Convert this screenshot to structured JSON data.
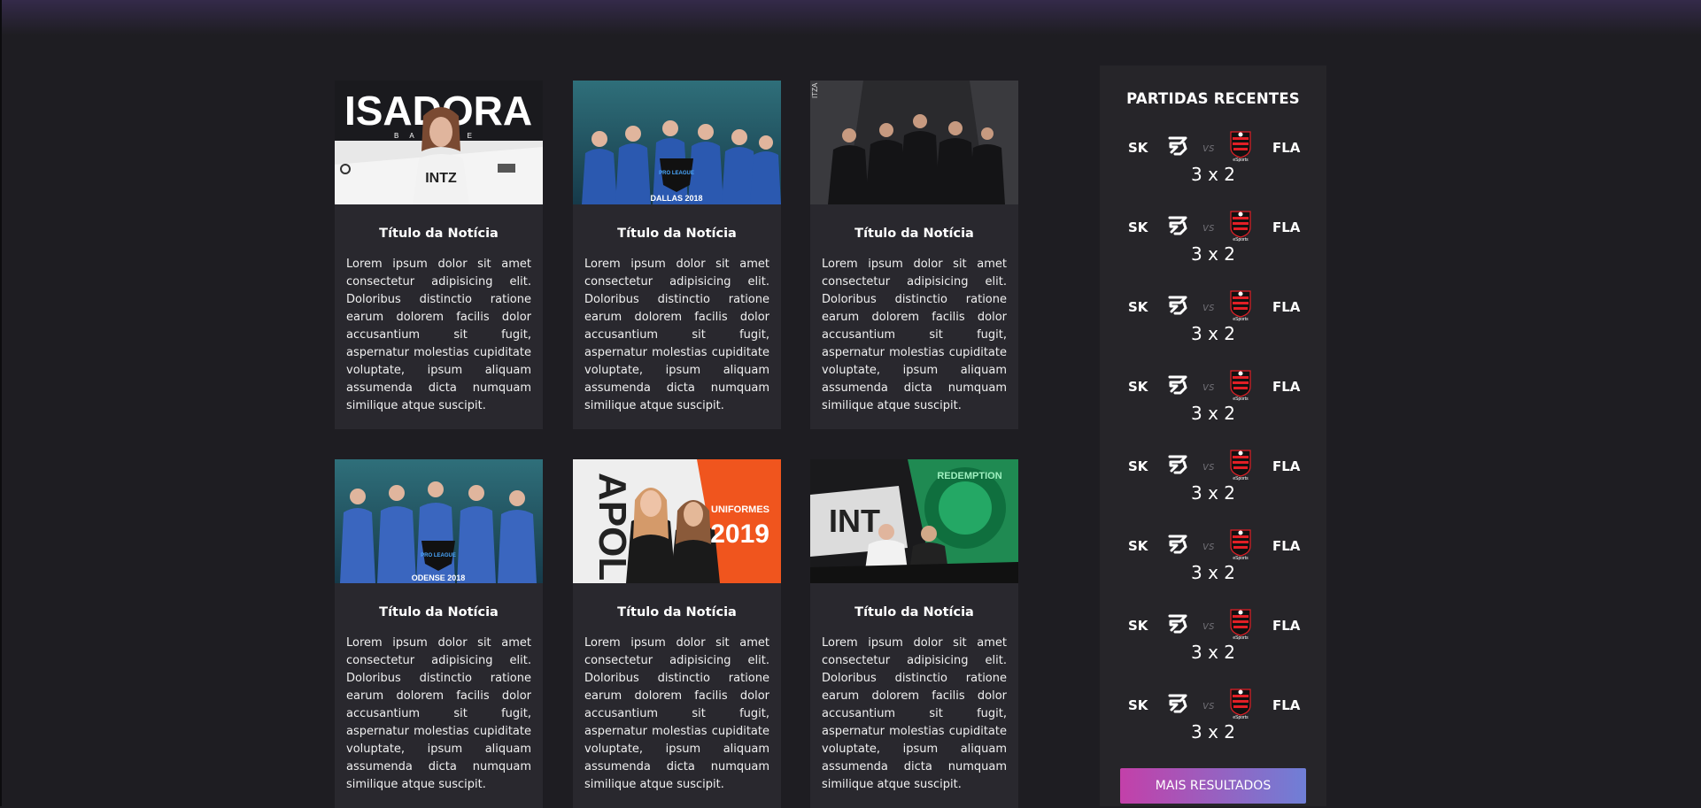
{
  "news": {
    "cards": [
      {
        "title": "Título da Notícia",
        "text": "Lorem ipsum dolor sit amet consectetur adipisicing elit. Doloribus distinctio ratione earum dolorem facilis dolor accusantium sit fugit, aspernatur molestias cupiditate voluptate, ipsum aliquam assumenda dicta numquam similique atque suscipit.",
        "image": {
          "headline": "ISADORA",
          "subline": "BASILE",
          "badge": "INTZ"
        }
      },
      {
        "title": "Título da Notícia",
        "text": "Lorem ipsum dolor sit amet consectetur adipisicing elit. Doloribus distinctio ratione earum dolorem facilis dolor accusantium sit fugit, aspernatur molestias cupiditate voluptate, ipsum aliquam assumenda dicta numquam similique atque suscipit.",
        "image": {
          "league": "PRO LEAGUE",
          "caption": "DALLAS 2018"
        }
      },
      {
        "title": "Título da Notícia",
        "text": "Lorem ipsum dolor sit amet consectetur adipisicing elit. Doloribus distinctio ratione earum dolorem facilis dolor accusantium sit fugit, aspernatur molestias cupiditate voluptate, ipsum aliquam assumenda dicta numquam similique atque suscipit.",
        "image": {
          "side": "ITZA"
        }
      },
      {
        "title": "Título da Notícia",
        "text": "Lorem ipsum dolor sit amet consectetur adipisicing elit. Doloribus distinctio ratione earum dolorem facilis dolor accusantium sit fugit, aspernatur molestias cupiditate voluptate, ipsum aliquam assumenda dicta numquam similique atque suscipit.",
        "image": {
          "league": "PRO LEAGUE",
          "caption": "ODENSE 2018"
        }
      },
      {
        "title": "Título da Notícia",
        "text": "Lorem ipsum dolor sit amet consectetur adipisicing elit. Doloribus distinctio ratione earum dolorem facilis dolor accusantium sit fugit, aspernatur molestias cupiditate voluptate, ipsum aliquam assumenda dicta numquam similique atque suscipit.",
        "image": {
          "side": "APOLLO",
          "headline": "UNIFORMES",
          "year": "2019"
        }
      },
      {
        "title": "Título da Notícia",
        "text": "Lorem ipsum dolor sit amet consectetur adipisicing elit. Doloribus distinctio ratione earum dolorem facilis dolor accusantium sit fugit, aspernatur molestias cupiditate voluptate, ipsum aliquam assumenda dicta numquam similique atque suscipit.",
        "image": {
          "left": "INT",
          "right": "REDEMPTION"
        }
      }
    ]
  },
  "sidebar": {
    "title": "PARTIDAS RECENTES",
    "vs": "vs",
    "matches": [
      {
        "team_a": "SK",
        "team_b": "FLA",
        "score": "3 x 2",
        "logo_a": "sk-logo",
        "logo_b": "flamengo-esports-logo",
        "fla_caption": "eSports"
      },
      {
        "team_a": "SK",
        "team_b": "FLA",
        "score": "3 x 2",
        "logo_a": "sk-logo",
        "logo_b": "flamengo-esports-logo",
        "fla_caption": "eSports"
      },
      {
        "team_a": "SK",
        "team_b": "FLA",
        "score": "3 x 2",
        "logo_a": "sk-logo",
        "logo_b": "flamengo-esports-logo",
        "fla_caption": "eSports"
      },
      {
        "team_a": "SK",
        "team_b": "FLA",
        "score": "3 x 2",
        "logo_a": "sk-logo",
        "logo_b": "flamengo-esports-logo",
        "fla_caption": "eSports"
      },
      {
        "team_a": "SK",
        "team_b": "FLA",
        "score": "3 x 2",
        "logo_a": "sk-logo",
        "logo_b": "flamengo-esports-logo",
        "fla_caption": "eSports"
      },
      {
        "team_a": "SK",
        "team_b": "FLA",
        "score": "3 x 2",
        "logo_a": "sk-logo",
        "logo_b": "flamengo-esports-logo",
        "fla_caption": "eSports"
      },
      {
        "team_a": "SK",
        "team_b": "FLA",
        "score": "3 x 2",
        "logo_a": "sk-logo",
        "logo_b": "flamengo-esports-logo",
        "fla_caption": "eSports"
      },
      {
        "team_a": "SK",
        "team_b": "FLA",
        "score": "3 x 2",
        "logo_a": "sk-logo",
        "logo_b": "flamengo-esports-logo",
        "fla_caption": "eSports"
      }
    ],
    "more_button": "MAIS RESULTADOS"
  },
  "colors": {
    "background": "#1e1d22",
    "card": "#29282e",
    "sidebar": "#262529",
    "button_gradient_start": "#c340a9",
    "button_gradient_end": "#6f7fd6"
  }
}
